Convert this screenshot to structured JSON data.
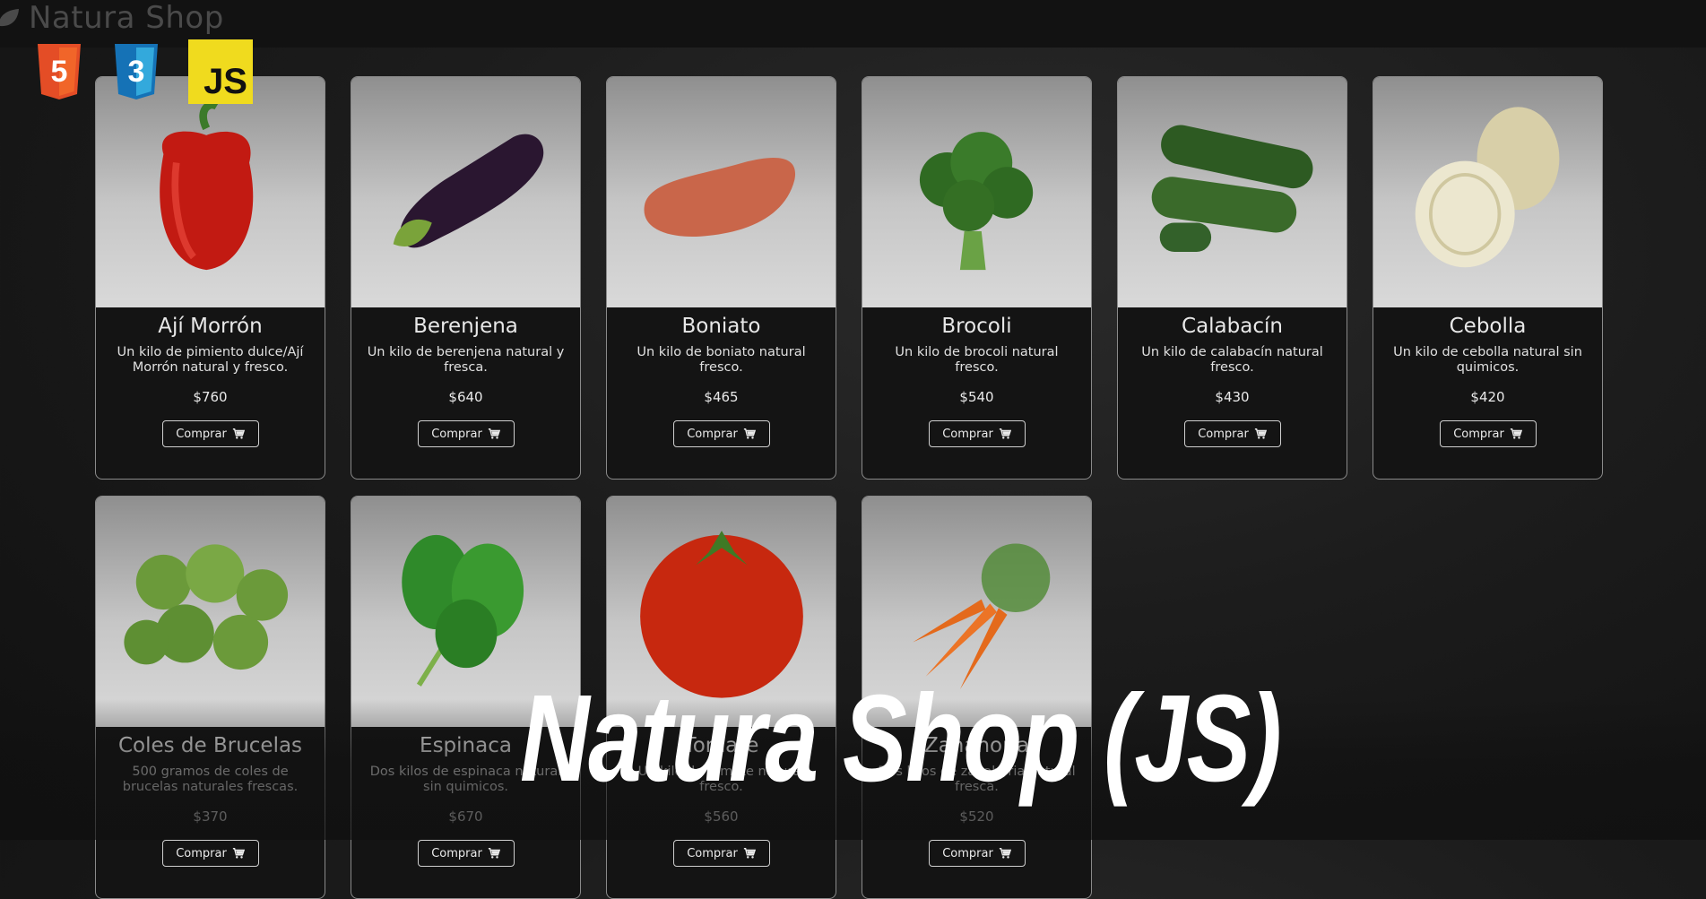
{
  "navbar": {
    "brand": "Natura Shop"
  },
  "badges": {
    "html": "5",
    "css": "3",
    "js": "JS"
  },
  "buy_label": "Comprar",
  "products": [
    {
      "name": "Ají Morrón",
      "desc": "Un kilo de pimiento dulce/Ají Morrón natural y fresco.",
      "price": "$760",
      "icon": "red-pepper"
    },
    {
      "name": "Berenjena",
      "desc": "Un kilo de berenjena natural y fresca.",
      "price": "$640",
      "icon": "eggplant"
    },
    {
      "name": "Boniato",
      "desc": "Un kilo de boniato natural fresco.",
      "price": "$465",
      "icon": "sweet-potato"
    },
    {
      "name": "Brocoli",
      "desc": "Un kilo de brocoli natural fresco.",
      "price": "$540",
      "icon": "broccoli"
    },
    {
      "name": "Calabacín",
      "desc": "Un kilo de calabacín natural fresco.",
      "price": "$430",
      "icon": "zucchini"
    },
    {
      "name": "Cebolla",
      "desc": "Un kilo de cebolla natural sin quimicos.",
      "price": "$420",
      "icon": "onion"
    },
    {
      "name": "Coles de Brucelas",
      "desc": "500 gramos de coles de brucelas naturales frescas.",
      "price": "$370",
      "icon": "brussels-sprouts"
    },
    {
      "name": "Espinaca",
      "desc": "Dos kilos de espinaca natural sin quimicos.",
      "price": "$670",
      "icon": "spinach"
    },
    {
      "name": "Tomate",
      "desc": "Un kilo de tomate natural fresco.",
      "price": "$560",
      "icon": "tomato"
    },
    {
      "name": "Zanahoria",
      "desc": "Dos kilos de zanahoria natural fresca.",
      "price": "$520",
      "icon": "carrot"
    }
  ],
  "overlay": {
    "title": "Natura Shop (JS)"
  }
}
